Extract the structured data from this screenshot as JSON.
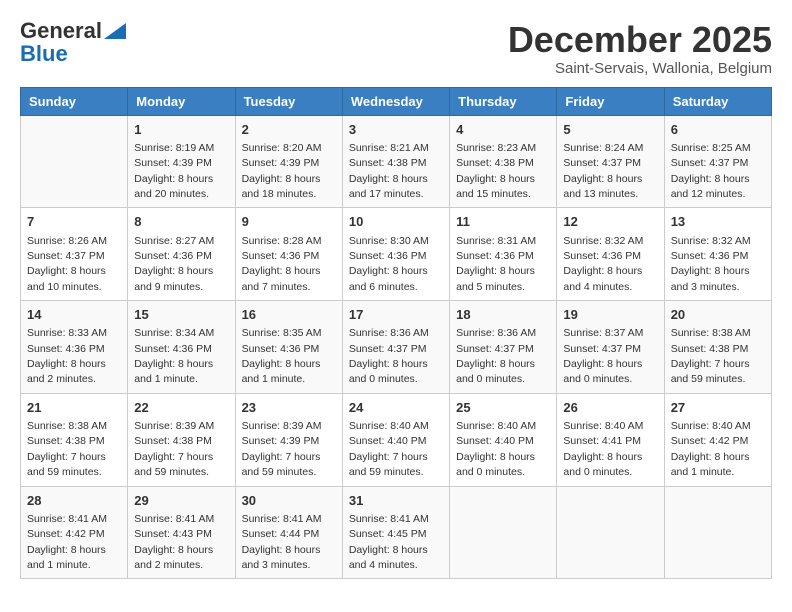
{
  "logo": {
    "line1": "General",
    "line2": "Blue"
  },
  "title": "December 2025",
  "subtitle": "Saint-Servais, Wallonia, Belgium",
  "days_header": [
    "Sunday",
    "Monday",
    "Tuesday",
    "Wednesday",
    "Thursday",
    "Friday",
    "Saturday"
  ],
  "weeks": [
    [
      {
        "day": "",
        "sunrise": "",
        "sunset": "",
        "daylight": ""
      },
      {
        "day": "1",
        "sunrise": "8:19 AM",
        "sunset": "4:39 PM",
        "daylight": "8 hours and 20 minutes."
      },
      {
        "day": "2",
        "sunrise": "8:20 AM",
        "sunset": "4:39 PM",
        "daylight": "8 hours and 18 minutes."
      },
      {
        "day": "3",
        "sunrise": "8:21 AM",
        "sunset": "4:38 PM",
        "daylight": "8 hours and 17 minutes."
      },
      {
        "day": "4",
        "sunrise": "8:23 AM",
        "sunset": "4:38 PM",
        "daylight": "8 hours and 15 minutes."
      },
      {
        "day": "5",
        "sunrise": "8:24 AM",
        "sunset": "4:37 PM",
        "daylight": "8 hours and 13 minutes."
      },
      {
        "day": "6",
        "sunrise": "8:25 AM",
        "sunset": "4:37 PM",
        "daylight": "8 hours and 12 minutes."
      }
    ],
    [
      {
        "day": "7",
        "sunrise": "8:26 AM",
        "sunset": "4:37 PM",
        "daylight": "8 hours and 10 minutes."
      },
      {
        "day": "8",
        "sunrise": "8:27 AM",
        "sunset": "4:36 PM",
        "daylight": "8 hours and 9 minutes."
      },
      {
        "day": "9",
        "sunrise": "8:28 AM",
        "sunset": "4:36 PM",
        "daylight": "8 hours and 7 minutes."
      },
      {
        "day": "10",
        "sunrise": "8:30 AM",
        "sunset": "4:36 PM",
        "daylight": "8 hours and 6 minutes."
      },
      {
        "day": "11",
        "sunrise": "8:31 AM",
        "sunset": "4:36 PM",
        "daylight": "8 hours and 5 minutes."
      },
      {
        "day": "12",
        "sunrise": "8:32 AM",
        "sunset": "4:36 PM",
        "daylight": "8 hours and 4 minutes."
      },
      {
        "day": "13",
        "sunrise": "8:32 AM",
        "sunset": "4:36 PM",
        "daylight": "8 hours and 3 minutes."
      }
    ],
    [
      {
        "day": "14",
        "sunrise": "8:33 AM",
        "sunset": "4:36 PM",
        "daylight": "8 hours and 2 minutes."
      },
      {
        "day": "15",
        "sunrise": "8:34 AM",
        "sunset": "4:36 PM",
        "daylight": "8 hours and 1 minute."
      },
      {
        "day": "16",
        "sunrise": "8:35 AM",
        "sunset": "4:36 PM",
        "daylight": "8 hours and 1 minute."
      },
      {
        "day": "17",
        "sunrise": "8:36 AM",
        "sunset": "4:37 PM",
        "daylight": "8 hours and 0 minutes."
      },
      {
        "day": "18",
        "sunrise": "8:36 AM",
        "sunset": "4:37 PM",
        "daylight": "8 hours and 0 minutes."
      },
      {
        "day": "19",
        "sunrise": "8:37 AM",
        "sunset": "4:37 PM",
        "daylight": "8 hours and 0 minutes."
      },
      {
        "day": "20",
        "sunrise": "8:38 AM",
        "sunset": "4:38 PM",
        "daylight": "7 hours and 59 minutes."
      }
    ],
    [
      {
        "day": "21",
        "sunrise": "8:38 AM",
        "sunset": "4:38 PM",
        "daylight": "7 hours and 59 minutes."
      },
      {
        "day": "22",
        "sunrise": "8:39 AM",
        "sunset": "4:38 PM",
        "daylight": "7 hours and 59 minutes."
      },
      {
        "day": "23",
        "sunrise": "8:39 AM",
        "sunset": "4:39 PM",
        "daylight": "7 hours and 59 minutes."
      },
      {
        "day": "24",
        "sunrise": "8:40 AM",
        "sunset": "4:40 PM",
        "daylight": "7 hours and 59 minutes."
      },
      {
        "day": "25",
        "sunrise": "8:40 AM",
        "sunset": "4:40 PM",
        "daylight": "8 hours and 0 minutes."
      },
      {
        "day": "26",
        "sunrise": "8:40 AM",
        "sunset": "4:41 PM",
        "daylight": "8 hours and 0 minutes."
      },
      {
        "day": "27",
        "sunrise": "8:40 AM",
        "sunset": "4:42 PM",
        "daylight": "8 hours and 1 minute."
      }
    ],
    [
      {
        "day": "28",
        "sunrise": "8:41 AM",
        "sunset": "4:42 PM",
        "daylight": "8 hours and 1 minute."
      },
      {
        "day": "29",
        "sunrise": "8:41 AM",
        "sunset": "4:43 PM",
        "daylight": "8 hours and 2 minutes."
      },
      {
        "day": "30",
        "sunrise": "8:41 AM",
        "sunset": "4:44 PM",
        "daylight": "8 hours and 3 minutes."
      },
      {
        "day": "31",
        "sunrise": "8:41 AM",
        "sunset": "4:45 PM",
        "daylight": "8 hours and 4 minutes."
      },
      {
        "day": "",
        "sunrise": "",
        "sunset": "",
        "daylight": ""
      },
      {
        "day": "",
        "sunrise": "",
        "sunset": "",
        "daylight": ""
      },
      {
        "day": "",
        "sunrise": "",
        "sunset": "",
        "daylight": ""
      }
    ]
  ]
}
